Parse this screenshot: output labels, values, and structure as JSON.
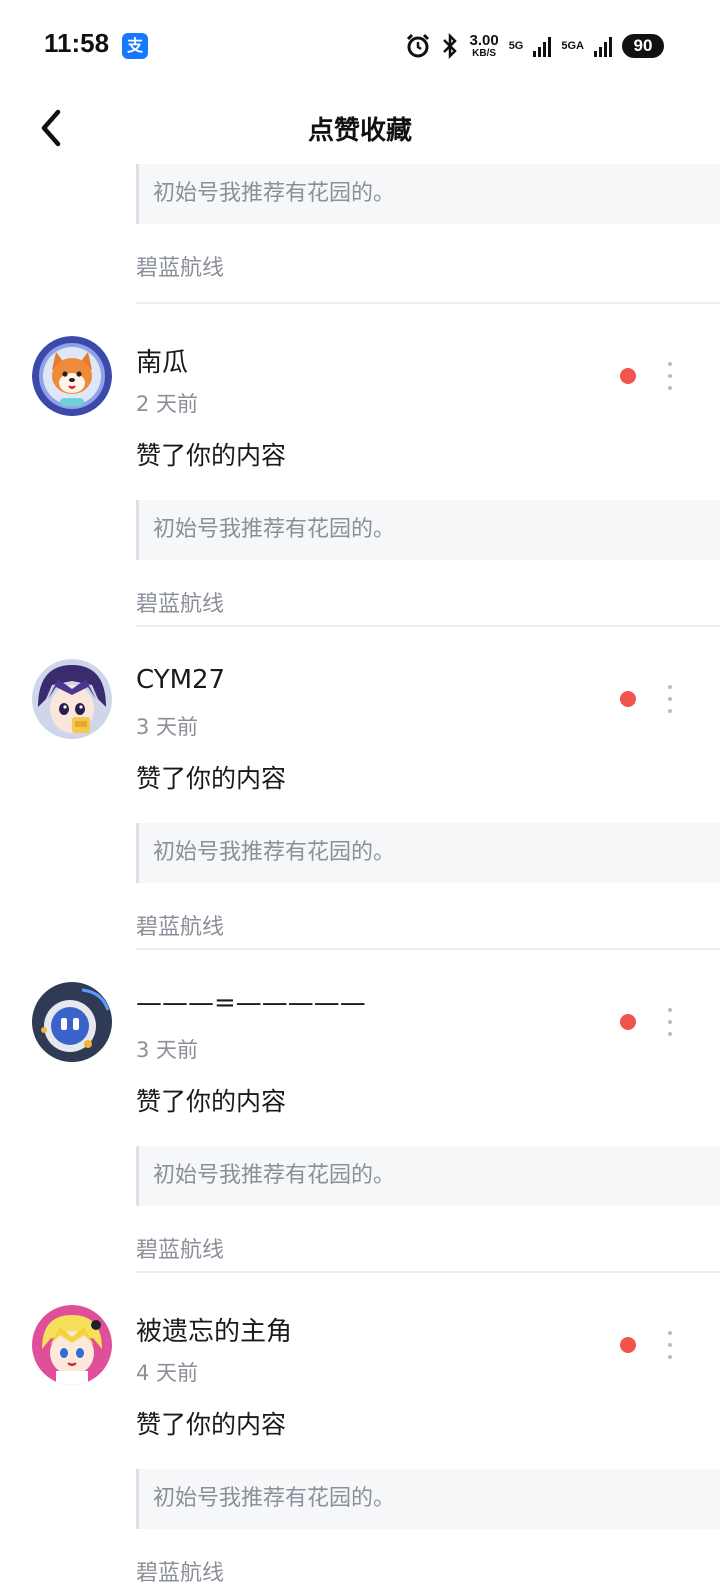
{
  "status_bar": {
    "time": "11:58",
    "alipay_glyph": "支",
    "speed_value": "3.00",
    "speed_unit": "KB/S",
    "net1": "5G",
    "net2": "5GA",
    "battery": "90"
  },
  "nav": {
    "title": "点赞收藏"
  },
  "partial_item": {
    "quote": "初始号我推荐有花园的。",
    "source": "碧蓝航线"
  },
  "items": [
    {
      "username": "南瓜",
      "time": "2 天前",
      "action": "赞了你的内容",
      "quote": "初始号我推荐有花园的。",
      "source": "碧蓝航线",
      "avatar_icon": "shiba-dog-avatar"
    },
    {
      "username": "CYM27",
      "time": "3 天前",
      "action": "赞了你的内容",
      "quote": "初始号我推荐有花园的。",
      "source": "碧蓝航线",
      "avatar_icon": "anime-boy-avatar"
    },
    {
      "username": "———=—————",
      "time": "3 天前",
      "action": "赞了你的内容",
      "quote": "初始号我推荐有花园的。",
      "source": "碧蓝航线",
      "avatar_icon": "robot-avatar"
    },
    {
      "username": "被遗忘的主角",
      "time": "4 天前",
      "action": "赞了你的内容",
      "quote": "初始号我推荐有花园的。",
      "source": "碧蓝航线",
      "avatar_icon": "anime-girl-avatar"
    }
  ],
  "colors": {
    "unread_dot": "#f0544d",
    "secondary_text": "#8a8f99",
    "quote_bg": "#f6f7f9"
  }
}
